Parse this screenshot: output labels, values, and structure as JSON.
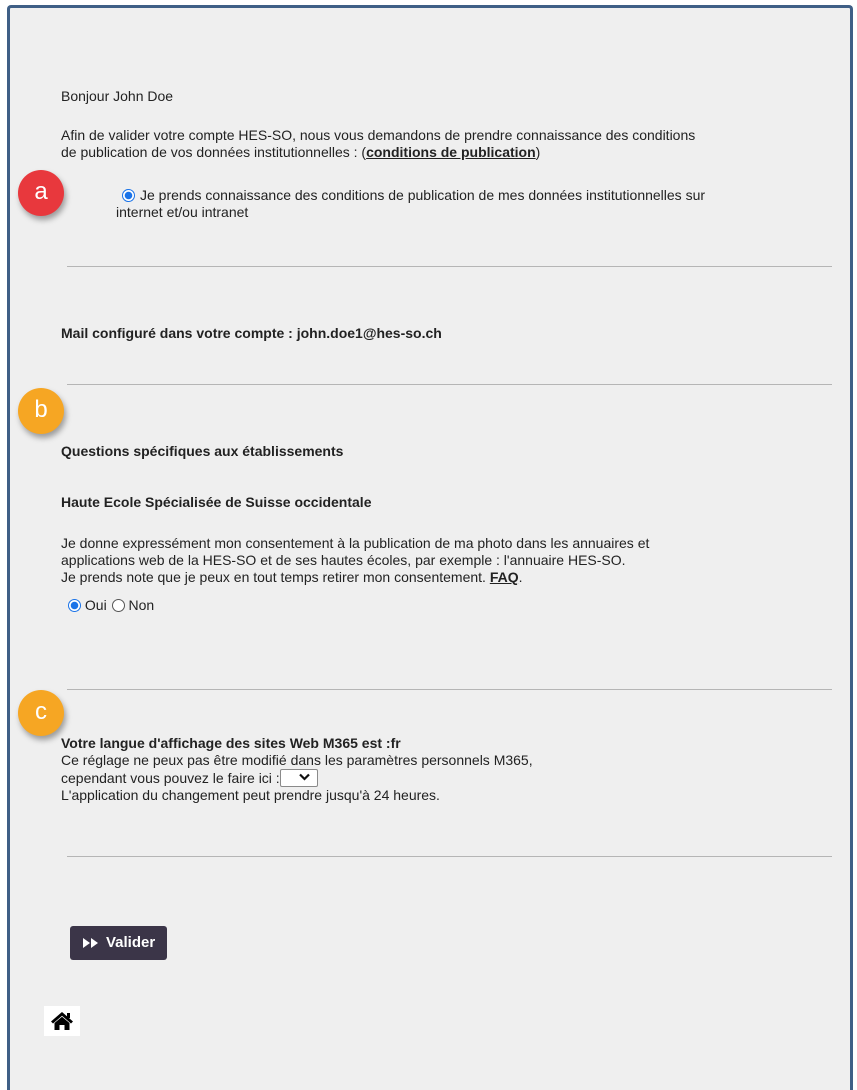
{
  "greeting": "Bonjour John Doe",
  "intro": {
    "line1": "Afin de valider votre compte HES-SO, nous vous demandons de prendre connaissance des conditions",
    "line2_prefix": "de publication de vos données institutionnelles : (",
    "link": "conditions de publication",
    "line2_suffix": ")"
  },
  "consent_ack": {
    "line1": "Je prends connaissance des conditions de publication de mes données institutionnelles sur",
    "line2": "internet et/ou intranet",
    "checked": true
  },
  "mail": {
    "text": "Mail configuré dans votre compte : john.doe1@hes-so.ch"
  },
  "badges": {
    "a": "a",
    "b": "b",
    "c": "c"
  },
  "institution": {
    "section_title": "Questions spécifiques aux établissements",
    "school_title": "Haute Ecole Spécialisée de Suisse occidentale",
    "line1": "Je donne expressément mon consentement à la publication de ma photo dans les annuaires et",
    "line2": "applications web de la HES-SO et de ses hautes écoles, par exemple : l'annuaire HES-SO.",
    "line3_prefix": "Je prends note que je peux en tout temps retirer mon consentement. ",
    "faq_link": "FAQ",
    "line3_suffix": ".",
    "option_yes": "Oui",
    "option_no": "Non",
    "selected": "Oui"
  },
  "language": {
    "title": "Votre langue d'affichage des sites Web M365 est :fr",
    "line1": "Ce réglage ne peux pas être modifié dans les paramètres personnels M365,",
    "line2": "cependant vous pouvez le faire ici :",
    "line3": "L'application du changement peut prendre jusqu'à 24 heures.",
    "select_value": ""
  },
  "submit_button": {
    "label": "Valider",
    "icon": "fast-forward-icon"
  },
  "home": {
    "icon": "home-icon"
  },
  "colors": {
    "panel_bg": "#efefef",
    "panel_border": "#3f5f86",
    "badge_red": "#e8383d",
    "badge_orange": "#f6a623",
    "button_bg": "#3b3548",
    "radio_blue": "#1a73e8"
  }
}
